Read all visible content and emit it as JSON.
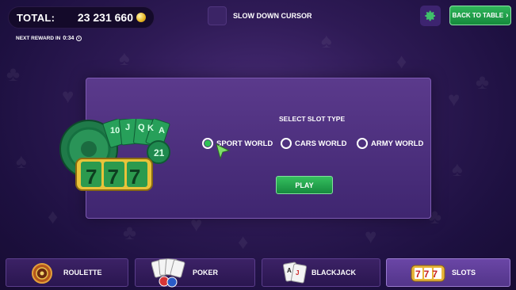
{
  "header": {
    "total_label": "TOTAL:",
    "total_value": "23 231 660",
    "reward_label": "NEXT REWARD IN",
    "reward_time": "0:34",
    "slow_cursor_label": "SLOW DOWN CURSOR",
    "back_label": "BACK TO TABLE"
  },
  "dialog": {
    "title": "SELECT SLOT TYPE",
    "options": [
      {
        "label": "SPORT WORLD",
        "selected": true
      },
      {
        "label": "CARS WORLD",
        "selected": false
      },
      {
        "label": "ARMY WORLD",
        "selected": false
      }
    ],
    "play_label": "PLAY",
    "art_digits": "777"
  },
  "tabs": [
    {
      "label": "ROULETTE",
      "icon": "roulette-icon",
      "active": false
    },
    {
      "label": "POKER",
      "icon": "poker-cards-icon",
      "active": false
    },
    {
      "label": "BLACKJACK",
      "icon": "blackjack-cards-icon",
      "active": false
    },
    {
      "label": "SLOTS",
      "icon": "slots-777-icon",
      "active": true
    }
  ],
  "colors": {
    "accent_green": "#2fb55a",
    "background": "#2e1a55",
    "dialog": "#5b3a8c"
  }
}
